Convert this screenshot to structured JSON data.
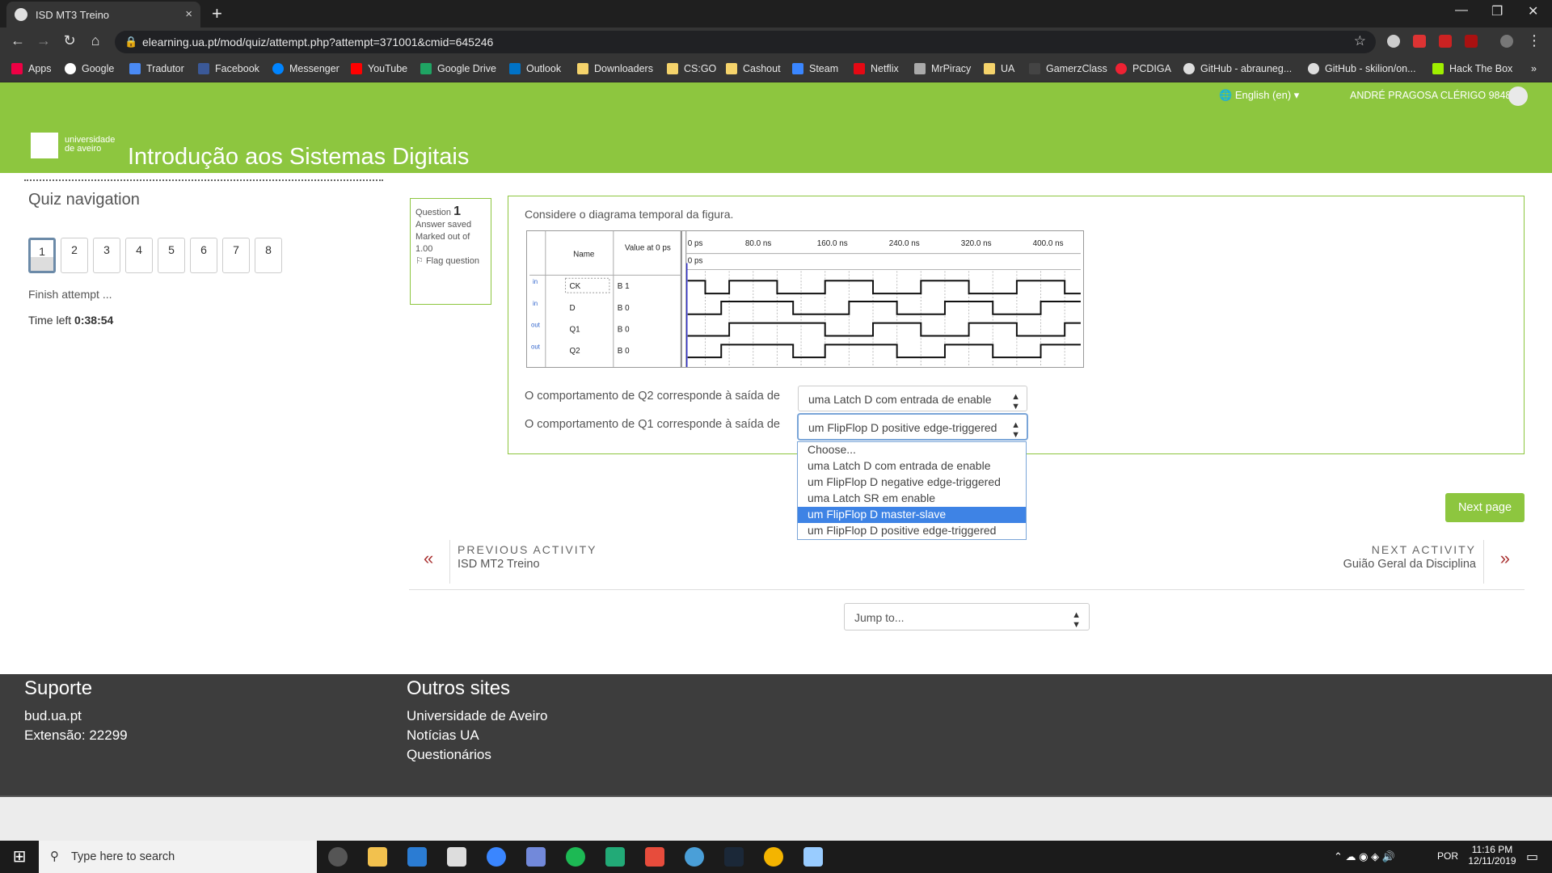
{
  "browser": {
    "tab_title": "ISD MT3 Treino",
    "tab_close": "×",
    "new_tab": "+",
    "url": "elearning.ua.pt/mod/quiz/attempt.php?attempt=371001&cmid=645246",
    "bookmarks": [
      "Apps",
      "Google",
      "Tradutor",
      "Facebook",
      "Messenger",
      "YouTube",
      "Google Drive",
      "Outlook",
      "Downloaders",
      "CS:GO",
      "Cashout",
      "Steam",
      "Netflix",
      "MrPiracy",
      "UA",
      "GamerzClass",
      "PCDIGA",
      "GitHub - abrauneg...",
      "GitHub - skilion/on...",
      "Hack The Box"
    ],
    "bookmarks_more": "»"
  },
  "moodle": {
    "language": "English (en)",
    "user_name": "ANDRÉ PRAGOSA CLÉRIGO 98485",
    "logo_line1": "universidade",
    "logo_line2": "de aveiro",
    "course_title": "Introdução aos Sistemas Digitais"
  },
  "quiz_nav": {
    "heading": "Quiz navigation",
    "questions": [
      "1",
      "2",
      "3",
      "4",
      "5",
      "6",
      "7",
      "8"
    ],
    "finish": "Finish attempt ...",
    "time_label": "Time left",
    "time_value": "0:38:54"
  },
  "question_info": {
    "label": "Question",
    "number": "1",
    "state": "Answer saved",
    "marks": "Marked out of 1.00",
    "flag": "Flag question"
  },
  "question": {
    "text": "Considere o diagrama temporal da figura.",
    "prompt_q2": "O comportamento de Q2 corresponde à saída de",
    "answer_q2": "uma Latch D com entrada de enable",
    "prompt_q1": "O comportamento de Q1 corresponde à saída de",
    "answer_q1": "um FlipFlop D positive edge-triggered",
    "options": [
      "Choose...",
      "uma Latch D com entrada de enable",
      "um FlipFlop D negative edge-triggered",
      "uma Latch SR em enable",
      "um FlipFlop D master-slave",
      "um FlipFlop D positive edge-triggered"
    ],
    "highlighted_option": "um FlipFlop D master-slave"
  },
  "diagram": {
    "col_name": "Name",
    "col_value": "Value at 0 ps",
    "ticks": [
      "0 ps",
      "80.0 ns",
      "160.0 ns",
      "240.0 ns",
      "320.0 ns",
      "400.0 ns"
    ],
    "cursor_label": "0 ps",
    "signals": [
      {
        "dir": "in",
        "name": "CK",
        "value": "B 1"
      },
      {
        "dir": "in",
        "name": "D",
        "value": "B 0"
      },
      {
        "dir": "out",
        "name": "Q1",
        "value": "B 0"
      },
      {
        "dir": "out",
        "name": "Q2",
        "value": "B 0"
      }
    ]
  },
  "next_page": "Next page",
  "activity_nav": {
    "prev_label": "PREVIOUS ACTIVITY",
    "prev_name": "ISD MT2 Treino",
    "next_label": "NEXT ACTIVITY",
    "next_name": "Guião Geral da Disciplina"
  },
  "jump_to": "Jump to...",
  "footer": {
    "support_heading": "Suporte",
    "support_lines": [
      "bud.ua.pt",
      "Extensão: 22299"
    ],
    "sites_heading": "Outros sites",
    "sites_links": [
      "Universidade de Aveiro",
      "Notícias UA",
      "Questionários"
    ]
  },
  "taskbar": {
    "search_placeholder": "Type here to search",
    "language": "POR",
    "time": "11:16 PM",
    "date": "12/11/2019"
  },
  "colors": {
    "brand_green": "#8dc63f",
    "footer_dark": "#3d3d3d",
    "highlight_blue": "#3e83e5"
  }
}
